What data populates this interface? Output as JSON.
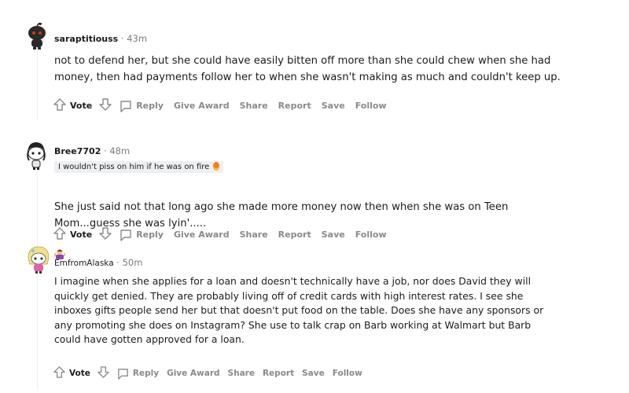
{
  "comments": [
    {
      "username": "saraptitiouss",
      "time": "43m",
      "text": "not to defend her, but she could have easily bitten off more than she could chew when she had\nmoney, then had payments follow her to when she wasn't making as much and couldn't keep up."
    },
    {
      "username": "Bree7702",
      "time": "48m",
      "flair": "I wouldn't piss on him if he was on fire",
      "text_main": "She just said not that long ago she made more money now then when she was on Teen\nMom...guess she was lyin'....."
    },
    {
      "username": "EmfromAlaska",
      "time": "50m",
      "text": "I imagine when she applies for a loan and doesn't technically have a job, nor does David they will\nquickly get denied. They are probably living off of credit cards with high interest rates. I see she\ninboxes gifts people send her but that doesn't put food on the table. Does she have any sponsors or\nany promoting she does on Instagram? She use to talk crap on Barb working at Walmart but Barb\ncould have gotten approved for a loan."
    }
  ],
  "actions": {
    "separator": "·",
    "vote": "Vote",
    "reply": "Reply",
    "give_award": "Give Award",
    "share": "Share",
    "report": "Report",
    "save": "Save",
    "follow": "Follow"
  }
}
